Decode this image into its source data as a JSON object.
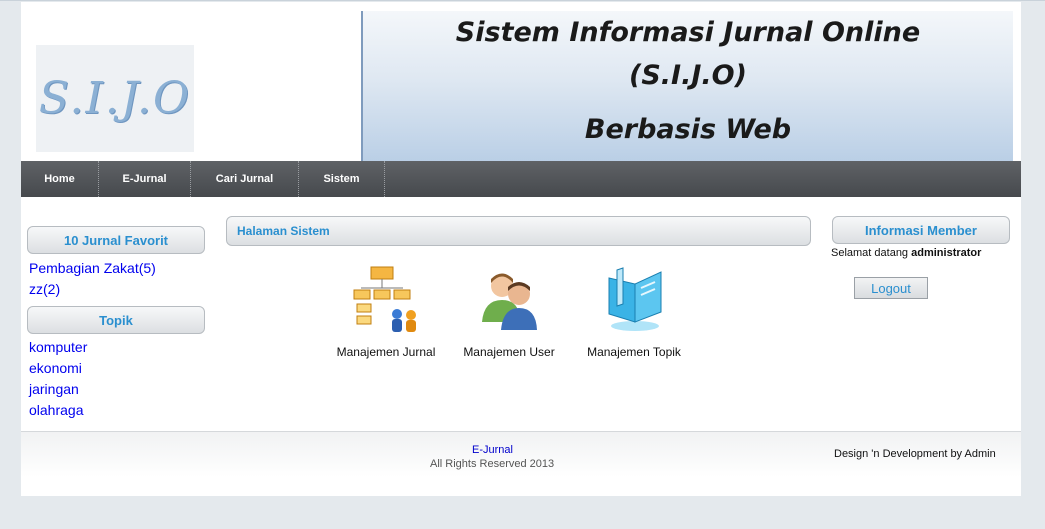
{
  "header": {
    "logo_text": "S.I.J.O",
    "banner_line1": "Sistem Informasi Jurnal Online",
    "banner_line2": "(S.I.J.O)",
    "banner_line3": "Berbasis Web"
  },
  "nav": {
    "items": [
      "Home",
      "E-Jurnal",
      "Cari Jurnal",
      "Sistem"
    ]
  },
  "left_sidebar": {
    "favorites_title": "10 Jurnal Favorit",
    "favorites": [
      "Pembagian Zakat(5)",
      "zz(2)"
    ],
    "topics_title": "Topik",
    "topics": [
      "komputer",
      "ekonomi",
      "jaringan",
      "olahraga"
    ]
  },
  "main": {
    "title": "Halaman Sistem",
    "menu": [
      {
        "label": "Manajemen Jurnal",
        "icon": "org-chart-icon"
      },
      {
        "label": "Manajemen User",
        "icon": "users-icon"
      },
      {
        "label": "Manajemen Topik",
        "icon": "book-icon"
      }
    ]
  },
  "right_sidebar": {
    "title": "Informasi Member",
    "greeting": "Selamat datang",
    "username": "administrator",
    "logout_label": "Logout"
  },
  "footer": {
    "link": "E-Jurnal",
    "copyright": "All Rights Reserved 2013",
    "credit": "Design 'n Development by Admin"
  },
  "colors": {
    "accent": "#2a8fcf",
    "nav_bg": "#4f5256",
    "link": "#0000ee"
  }
}
